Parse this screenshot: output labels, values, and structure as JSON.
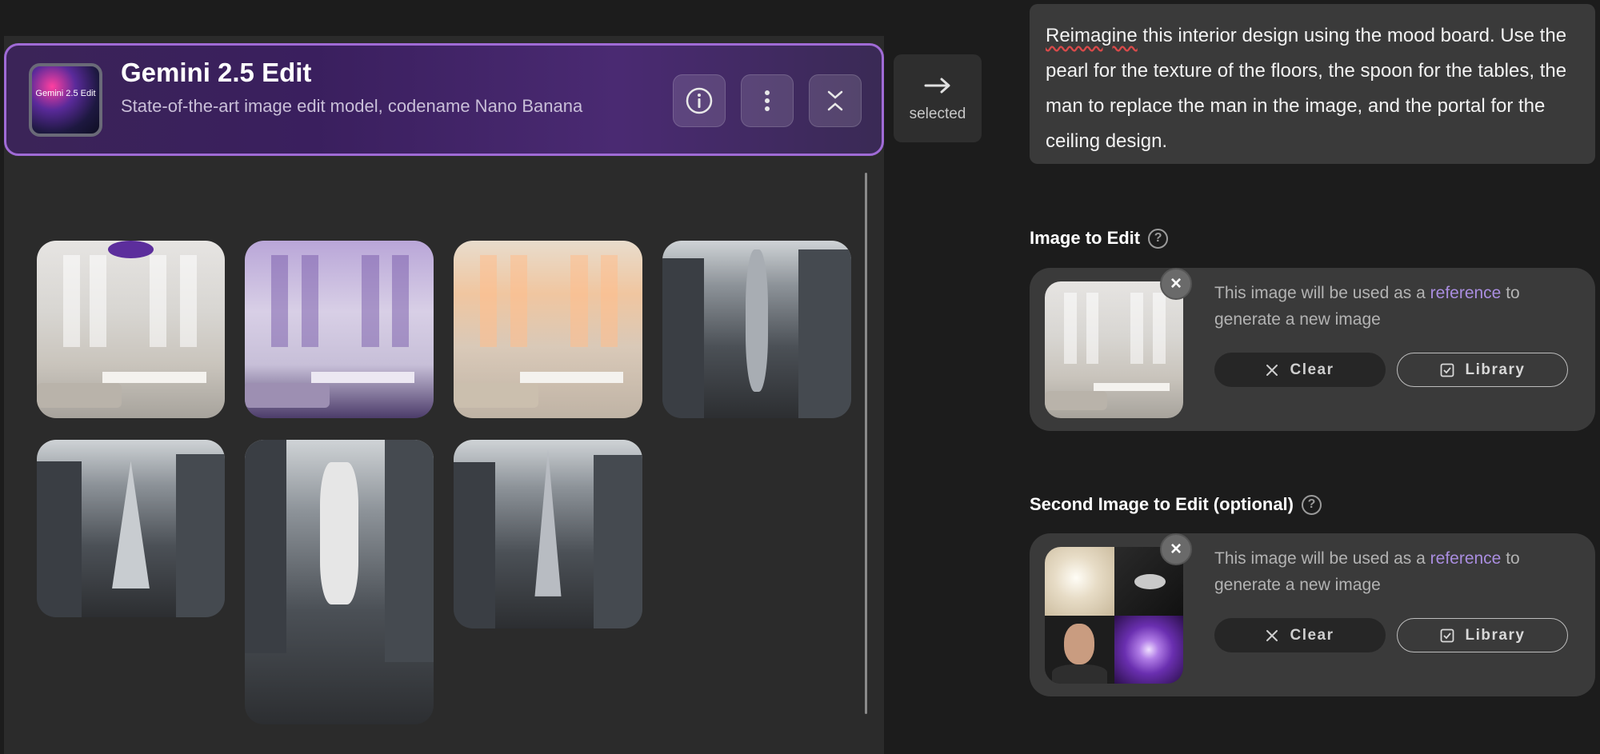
{
  "model": {
    "title": "Gemini 2.5 Edit",
    "description": "State-of-the-art image edit model, codename Nano Banana",
    "thumb_text": "Gemini 2.5 Edit",
    "accent_color": "#a06bd6"
  },
  "selected": {
    "label": "selected"
  },
  "prompt": {
    "first_word": "Reimagine",
    "text": " this interior design using the mood board. Use the pearl for the texture of the floors, the spoon for the tables, the man to replace the man in the image, and the portal for the ceiling design."
  },
  "image_to_edit": {
    "label": "Image to Edit",
    "ref_prefix": "This image will be used as a ",
    "ref_link": "reference",
    "ref_suffix": " to generate a new image",
    "clear_label": "Clear",
    "library_label": "Library"
  },
  "second_image": {
    "label": "Second Image to Edit (optional)",
    "ref_prefix": "This image will be used as a ",
    "ref_link": "reference",
    "ref_suffix": " to generate a new image",
    "clear_label": "Clear",
    "library_label": "Library"
  },
  "icons": {
    "info": "info-icon",
    "more": "more-vertical-icon",
    "collapse": "collapse-icon",
    "arrow": "arrow-right-icon",
    "help": "help-icon",
    "remove": "close-icon",
    "clear": "x-icon",
    "library": "checkbox-icon"
  }
}
